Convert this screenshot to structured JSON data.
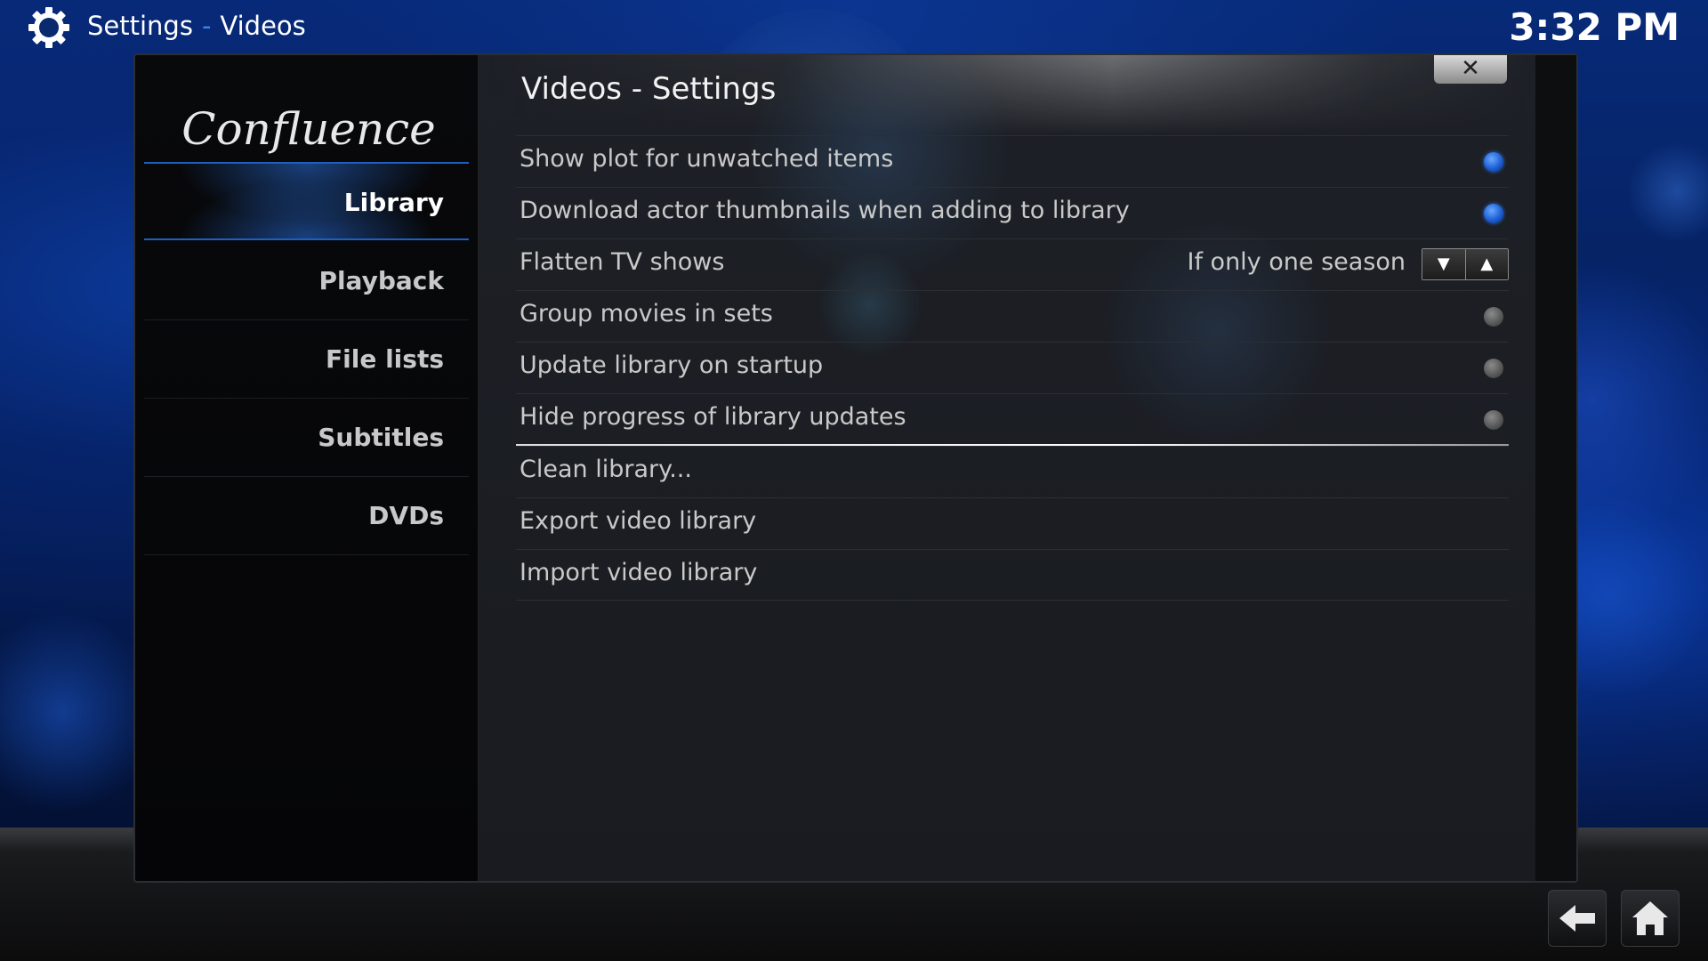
{
  "header": {
    "breadcrumb_root": "Settings",
    "breadcrumb_separator": "-",
    "breadcrumb_current": "Videos",
    "clock": "3:32 PM",
    "icon": "gear-icon"
  },
  "sidebar": {
    "logo_text": "Confluence",
    "items": [
      {
        "label": "Library",
        "active": true
      },
      {
        "label": "Playback",
        "active": false
      },
      {
        "label": "File lists",
        "active": false
      },
      {
        "label": "Subtitles",
        "active": false
      },
      {
        "label": "DVDs",
        "active": false
      }
    ]
  },
  "panel": {
    "title": "Videos - Settings",
    "close_icon": "close-icon",
    "settings": [
      {
        "label": "Show plot for unwatched items",
        "type": "toggle",
        "enabled": true
      },
      {
        "label": "Download actor thumbnails when adding to library",
        "type": "toggle",
        "enabled": true
      },
      {
        "label": "Flatten TV shows",
        "type": "spinner",
        "value": "If only one season"
      },
      {
        "label": "Group movies in sets",
        "type": "toggle",
        "enabled": false
      },
      {
        "label": "Update library on startup",
        "type": "toggle",
        "enabled": false
      },
      {
        "label": "Hide progress of library updates",
        "type": "toggle",
        "enabled": false
      },
      {
        "label": "Clean library...",
        "type": "action"
      },
      {
        "label": "Export video library",
        "type": "action"
      },
      {
        "label": "Import video library",
        "type": "action"
      }
    ]
  },
  "footer": {
    "back_icon": "back-arrow-icon",
    "home_icon": "home-icon"
  },
  "colors": {
    "accent": "#1d5fd6",
    "background": "#041b52"
  }
}
